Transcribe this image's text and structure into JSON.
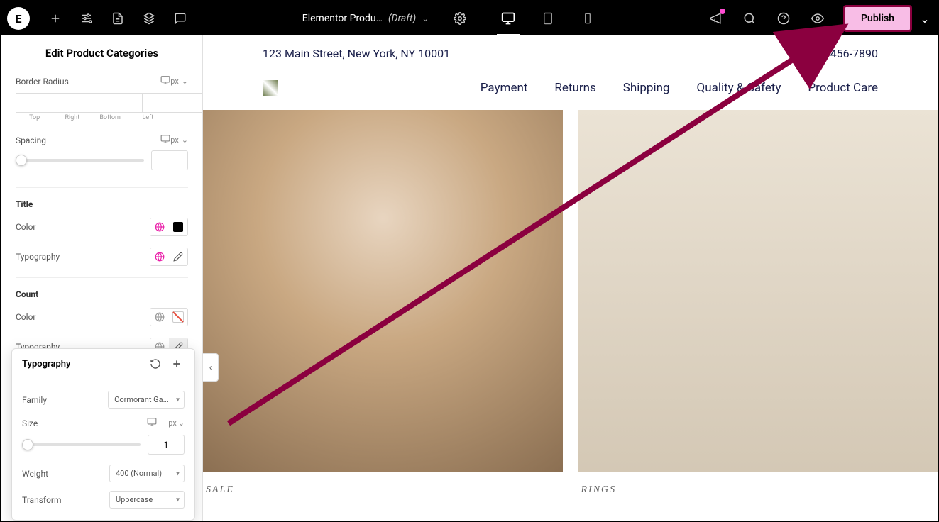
{
  "topbar": {
    "title": "Elementor Produ…",
    "status": "(Draft)",
    "publish_label": "Publish"
  },
  "sidebar": {
    "title": "Edit Product Categories",
    "border_radius": {
      "label": "Border Radius",
      "unit": "px",
      "corners": [
        "Top",
        "Right",
        "Bottom",
        "Left"
      ]
    },
    "spacing": {
      "label": "Spacing",
      "unit": "px"
    },
    "title_section": {
      "heading": "Title",
      "color_label": "Color",
      "typo_label": "Typography"
    },
    "count_section": {
      "heading": "Count",
      "color_label": "Color",
      "typo_label": "Typography"
    }
  },
  "popover": {
    "title": "Typography",
    "family_label": "Family",
    "family_value": "Cormorant Ga…",
    "size_label": "Size",
    "size_unit": "px",
    "size_value": "1",
    "weight_label": "Weight",
    "weight_value": "400 (Normal)",
    "transform_label": "Transform",
    "transform_value": "Uppercase"
  },
  "preview": {
    "address": "123 Main Street, New York, NY 10001",
    "phone": "123-456-7890",
    "menu": [
      "Payment",
      "Returns",
      "Shipping",
      "Quality & Safety",
      "Product Care"
    ],
    "products": [
      {
        "label": "SALE"
      },
      {
        "label": "RINGS"
      }
    ]
  }
}
